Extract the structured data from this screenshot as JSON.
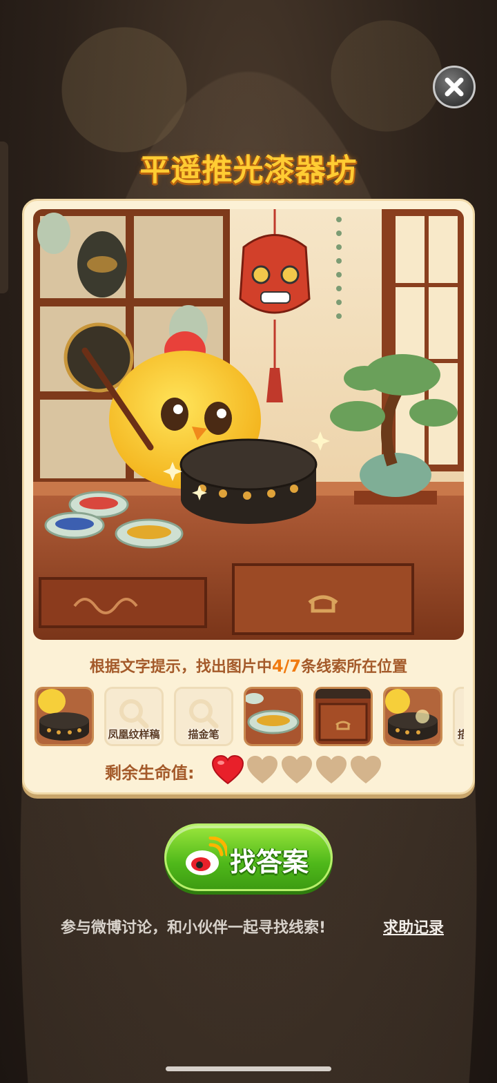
{
  "title": "平遥推光漆器坊",
  "hint": {
    "prefix": "根据文字提示，找出图片中",
    "count": "4/7",
    "suffix": "条线索所在位置"
  },
  "clues": [
    {
      "type": "found",
      "name": "lacquer-box"
    },
    {
      "type": "locked",
      "label": "凤凰纹样稿"
    },
    {
      "type": "locked",
      "label": "描金笔"
    },
    {
      "type": "found",
      "name": "paint-bowl"
    },
    {
      "type": "found",
      "name": "desk-drawer"
    },
    {
      "type": "found",
      "name": "lacquer-box-sparkle"
    },
    {
      "type": "locked",
      "label": "描"
    }
  ],
  "lives": {
    "label": "剩余生命值:",
    "remaining": 1,
    "total": 5
  },
  "find_button": {
    "label": "找答案"
  },
  "footer": {
    "text": "参与微博讨论，和小伙伴一起寻找线索!",
    "link": "求助记录"
  },
  "colors": {
    "accent_green": "#4fb81a",
    "title_gold": "#ffcc33",
    "hint_brown": "#a45a2a",
    "heart_red": "#e8202a",
    "heart_empty": "#d4b48c"
  }
}
